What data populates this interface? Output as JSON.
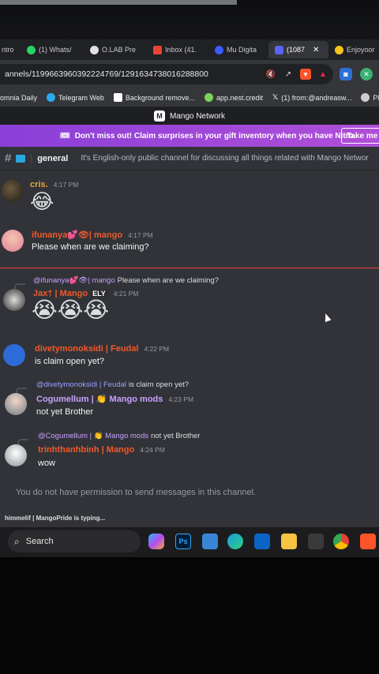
{
  "browser": {
    "tabs": [
      {
        "label": "ntro",
        "icon": "tab-icon"
      },
      {
        "label": "(1) Whats/",
        "icon": "whatsapp-icon"
      },
      {
        "label": "O.LAB Pre",
        "icon": "olab-icon"
      },
      {
        "label": "Inbox (41.",
        "icon": "gmail-icon"
      },
      {
        "label": "Mu Digita",
        "icon": "mudigital-icon"
      },
      {
        "label": "(1087",
        "icon": "discord-icon",
        "active": true
      },
      {
        "label": "Enjoyoor",
        "icon": "enjoyoor-icon"
      }
    ],
    "url": "annels/1199663960392224769/1291634738016288800",
    "bookmarks": [
      {
        "label": "omnia Daily"
      },
      {
        "label": "Telegram Web"
      },
      {
        "label": "Background remove..."
      },
      {
        "label": "app.nest.credit"
      },
      {
        "label": "(1) from:@andreasw..."
      },
      {
        "label": "Pl"
      }
    ]
  },
  "discord": {
    "server_title": "Mango Network",
    "nitro_banner": {
      "text": "Don't miss out! Claim surprises in your gift inventory when you have Nitro.",
      "button": "Take me t"
    },
    "channel": {
      "name": "general",
      "topic": "It's English-only public channel for discussing all things related with Mango Networ"
    },
    "messages": [
      {
        "author": "cris.",
        "time": "4:17 PM",
        "content": "😂"
      },
      {
        "author": "ifunanya💕👁| mango",
        "time": "4:17 PM",
        "content": "Please when are we claiming?"
      },
      {
        "reply_to": "@ifunanya💕👁| mango",
        "reply_text": "Please when are we claiming?",
        "author": "Jax† | Mango",
        "tag": "ELY",
        "time": "4:21 PM",
        "content": "😭😭😭"
      },
      {
        "author": "divetymonoksidi | Feudal",
        "time": "4:22 PM",
        "content": "is claim open yet?"
      },
      {
        "reply_to": "@divetymonoksidi | Feudal",
        "reply_text": "is claim open yet?",
        "author": "Cogumellum | 👏 Mango mods",
        "time": "4:23 PM",
        "content": "not yet Brother"
      },
      {
        "reply_to": "@Cogumellum | 👏 Mango mods",
        "reply_text": "not yet Brother",
        "author": "trinhthanhbinh | Mango",
        "time": "4:24 PM",
        "content": "wow"
      }
    ],
    "no_permission": "You do not have permission to send messages in this channel.",
    "typing": "himmelif | MangoPride is typing..."
  },
  "taskbar": {
    "search_label": "Search",
    "apps": [
      "copilot-icon",
      "photoshop-icon",
      "photos-icon",
      "edge-icon",
      "outlook-icon",
      "file-explorer-icon",
      "usb-icon",
      "chrome-icon",
      "brave-icon"
    ]
  },
  "colors": {
    "discord_bg": "#313338",
    "nitro_gradient_start": "#8b3fd8",
    "mango_orange": "#f0592b",
    "mod_purple": "#c9a0ff"
  }
}
